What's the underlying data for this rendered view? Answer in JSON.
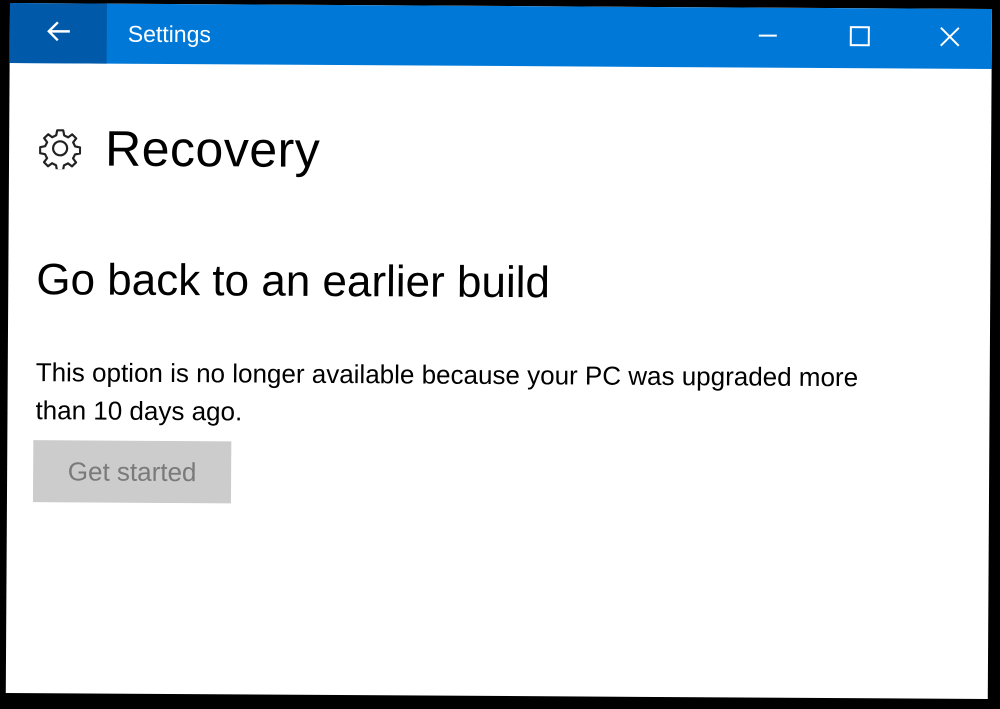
{
  "window": {
    "title": "Settings",
    "back_icon": "arrow-left-icon",
    "controls": [
      "minimize-icon",
      "maximize-icon",
      "close-icon"
    ]
  },
  "header": {
    "icon": "gear-icon",
    "title": "Recovery"
  },
  "section": {
    "title": "Go back to an earlier build",
    "description": "This option is no longer available because your PC was upgraded more than 10 days ago.",
    "button_label": "Get started",
    "button_enabled": false
  },
  "colors": {
    "titlebar": "#0078d7",
    "back_button": "#005aa9",
    "button_disabled_bg": "#cccccc",
    "button_disabled_text": "#7a7a7a"
  }
}
